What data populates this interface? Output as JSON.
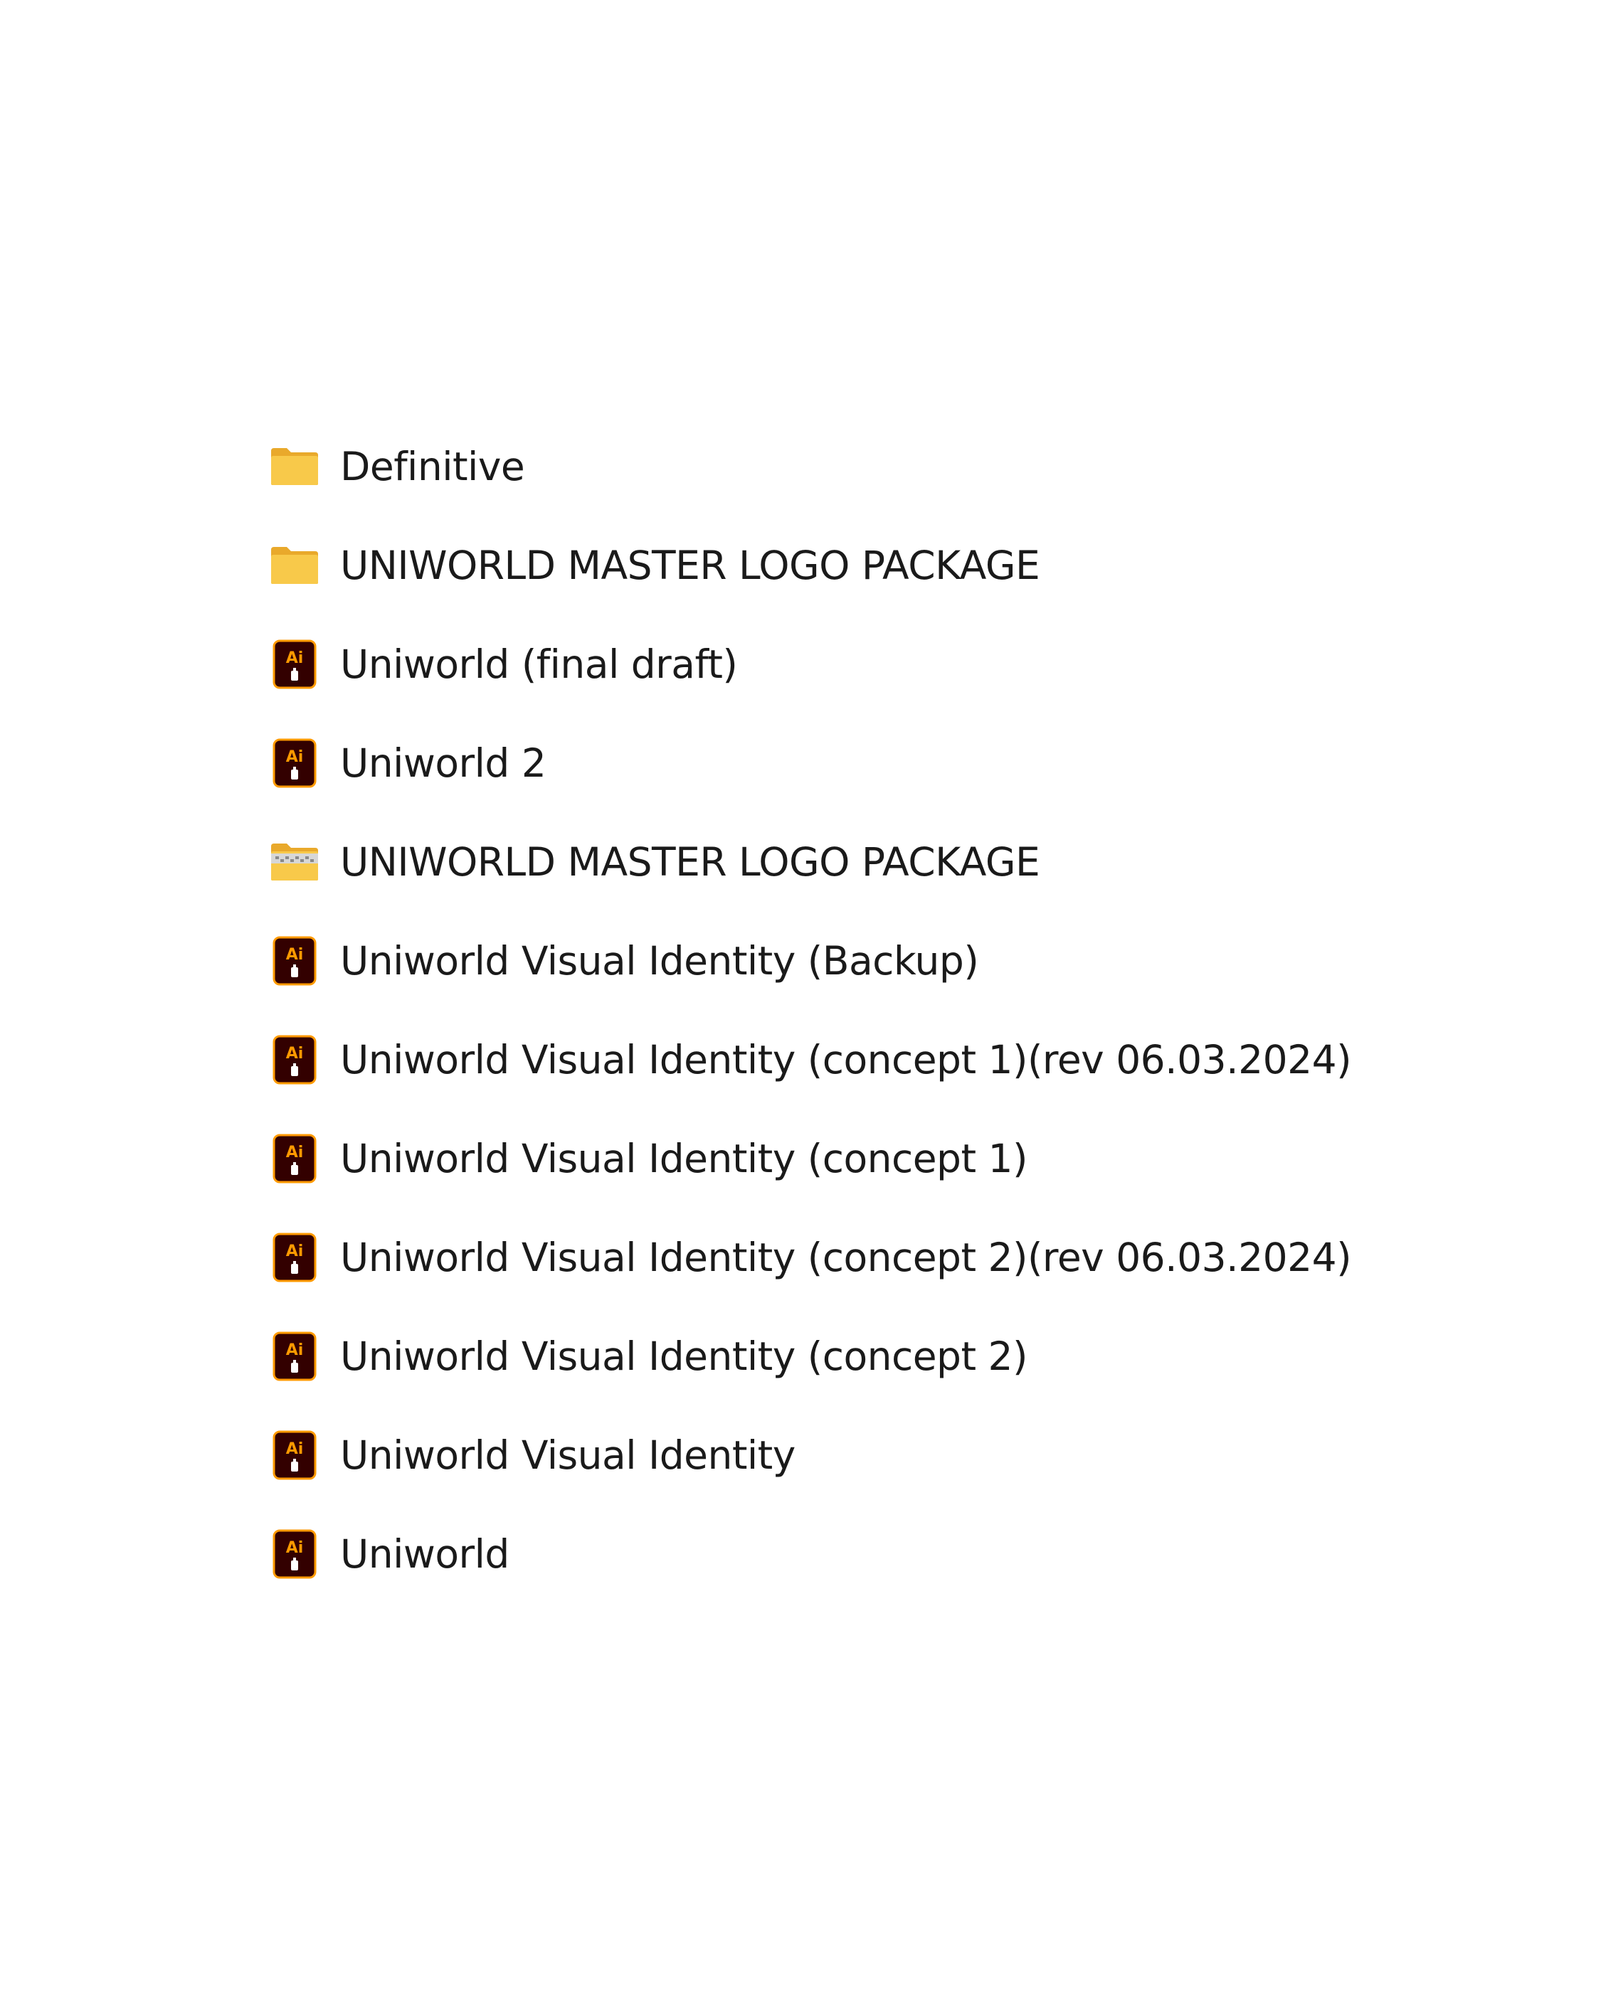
{
  "items": [
    {
      "name": "Definitive",
      "type": "folder",
      "icon": "folder-icon"
    },
    {
      "name": "UNIWORLD MASTER LOGO PACKAGE",
      "type": "folder",
      "icon": "folder-icon"
    },
    {
      "name": "Uniworld (final draft)",
      "type": "ai",
      "icon": "illustrator-file-icon"
    },
    {
      "name": "Uniworld 2",
      "type": "ai",
      "icon": "illustrator-file-icon"
    },
    {
      "name": "UNIWORLD MASTER LOGO PACKAGE",
      "type": "zip",
      "icon": "zip-folder-icon"
    },
    {
      "name": "Uniworld Visual Identity (Backup)",
      "type": "ai",
      "icon": "illustrator-file-icon"
    },
    {
      "name": "Uniworld Visual Identity (concept 1)(rev 06.03.2024)",
      "type": "ai",
      "icon": "illustrator-file-icon"
    },
    {
      "name": "Uniworld Visual Identity (concept 1)",
      "type": "ai",
      "icon": "illustrator-file-icon"
    },
    {
      "name": "Uniworld Visual Identity (concept 2)(rev 06.03.2024)",
      "type": "ai",
      "icon": "illustrator-file-icon"
    },
    {
      "name": "Uniworld Visual Identity (concept 2)",
      "type": "ai",
      "icon": "illustrator-file-icon"
    },
    {
      "name": "Uniworld Visual Identity",
      "type": "ai",
      "icon": "illustrator-file-icon"
    },
    {
      "name": "Uniworld",
      "type": "ai",
      "icon": "illustrator-file-icon"
    }
  ],
  "icon_text": {
    "ai": "Ai"
  },
  "colors": {
    "folder": "#F8C94A",
    "folder_back": "#E9A92B",
    "ai_bg": "#330000",
    "ai_accent": "#FF9A00",
    "text": "#1A1A1A",
    "background": "#FFFFFF"
  }
}
